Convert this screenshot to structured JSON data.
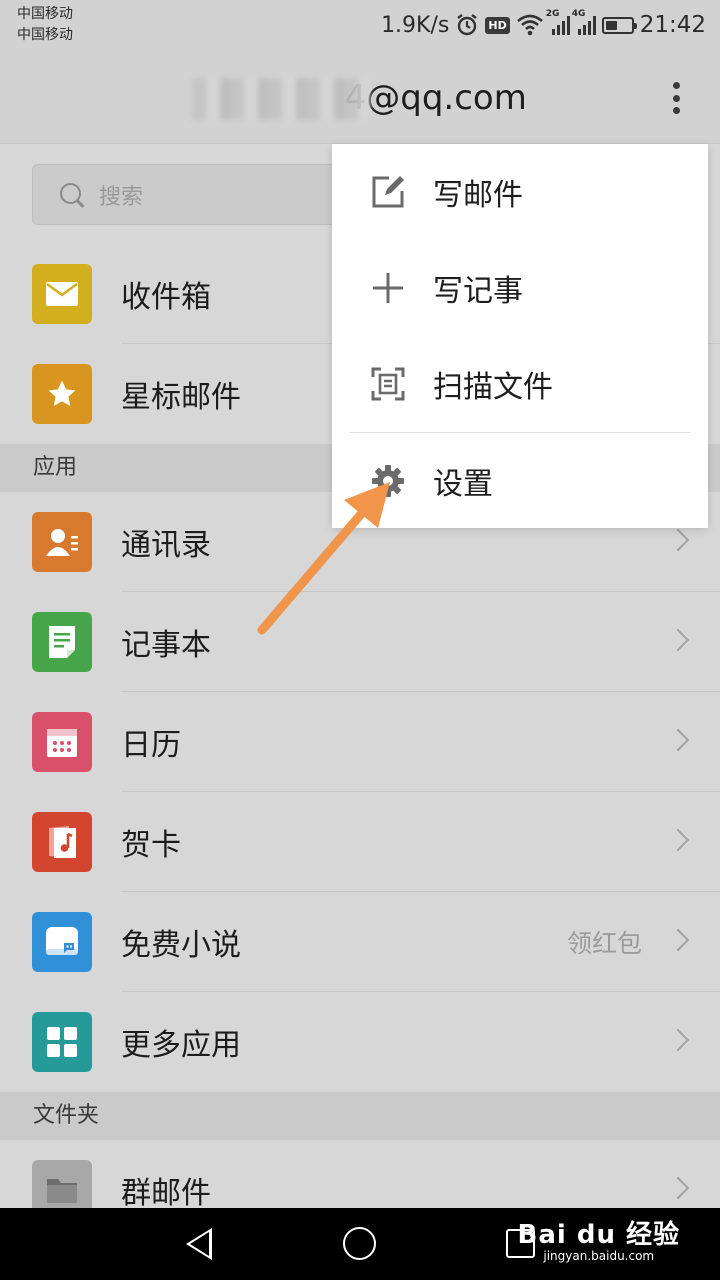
{
  "status_bar": {
    "carrier_1": "中国移动",
    "carrier_2": "中国移动",
    "net_speed": "1.9K/s",
    "hd_badge": "HD",
    "sig1_gen": "2G",
    "sig2_gen": "4G",
    "time": "21:42",
    "battery_level": 0.45
  },
  "header": {
    "account_visible": "@qq.com",
    "account_partial": "4@qq.com"
  },
  "search": {
    "placeholder": "搜索"
  },
  "mailbox": {
    "items": [
      {
        "label": "收件箱",
        "icon": "envelope-icon",
        "color": "#d3ae1e"
      },
      {
        "label": "星标邮件",
        "icon": "star-icon",
        "color": "#d8951f"
      }
    ]
  },
  "apps": {
    "section_title": "应用",
    "items": [
      {
        "label": "通讯录",
        "icon": "contacts-icon",
        "color": "#d87a2e"
      },
      {
        "label": "记事本",
        "icon": "notepad-icon",
        "color": "#47a64a"
      },
      {
        "label": "日历",
        "icon": "calendar-icon",
        "color": "#d9506a"
      },
      {
        "label": "贺卡",
        "icon": "greeting-card-icon",
        "color": "#d2452e"
      },
      {
        "label": "免费小说",
        "icon": "novel-icon",
        "color": "#2f8fd7",
        "extra": "领红包"
      },
      {
        "label": "更多应用",
        "icon": "more-apps-icon",
        "color": "#269a98"
      }
    ]
  },
  "folders": {
    "section_title": "文件夹",
    "items": [
      {
        "label": "群邮件",
        "icon": "folder-icon",
        "color": "#a8a8a8"
      }
    ]
  },
  "popup_menu": {
    "items": [
      {
        "label": "写邮件",
        "icon": "compose-icon"
      },
      {
        "label": "写记事",
        "icon": "plus-icon"
      },
      {
        "label": "扫描文件",
        "icon": "scan-icon"
      },
      {
        "label": "设置",
        "icon": "gear-icon"
      }
    ]
  },
  "annotation": {
    "color": "#f0954a"
  },
  "watermark": {
    "logo": "Bai du 经验",
    "url": "jingyan.baidu.com"
  }
}
